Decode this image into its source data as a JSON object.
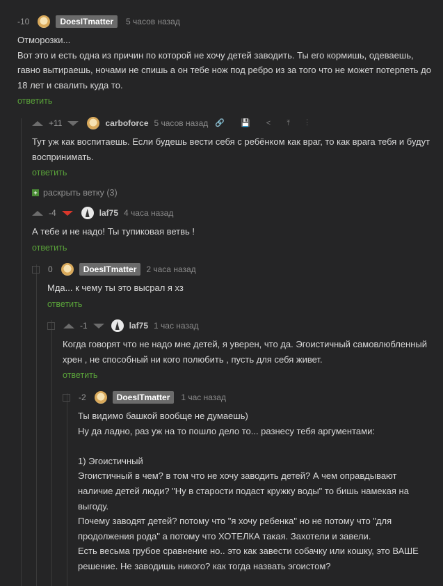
{
  "c1": {
    "rating": "-10",
    "author": "DoesITmatter",
    "time": "5 часов назад",
    "lines": [
      "Отморозки...",
      "Вот это и есть одна из причин по которой не хочу детей заводить. Ты его кормишь, одеваешь,",
      "гавно вытираешь, ночами не спишь а он тебе нож под ребро из за того что не может потерпеть до",
      "18 лет и свалить куда то."
    ],
    "reply": "ответить"
  },
  "c2": {
    "rating": "+11",
    "author": "carboforce",
    "time": "5 часов назад",
    "tools": "🔗 💾 < ⤒ ⋮",
    "lines": [
      "Тут уж как воспитаешь. Если будешь вести себя с ребёнком как враг, то как врага тебя и будут",
      "воспринимать."
    ],
    "reply": "ответить"
  },
  "branch": "раскрыть ветку (3)",
  "c3": {
    "rating": "-4",
    "author": "laf75",
    "time": "4 часа назад",
    "lines": [
      "А тебе и не надо! Ты тупиковая ветвь !"
    ],
    "reply": "ответить"
  },
  "c4": {
    "rating": "0",
    "author": "DoesITmatter",
    "time": "2 часа назад",
    "lines": [
      "Мда... к чему ты это высрал я хз"
    ],
    "reply": "ответить"
  },
  "c5": {
    "rating": "-1",
    "author": "laf75",
    "time": "1 час назад",
    "lines": [
      "Когда говорят что не надо мне детей, я уверен, что да. Эгоистичный самовлюбленный",
      "хрен , не способный ни кого полюбить , пусть для себя живет."
    ],
    "reply": "ответить"
  },
  "c6": {
    "rating": "-2",
    "author": "DoesITmatter",
    "time": "1 час назад",
    "lines": [
      "Ты видимо башкой вообще не думаешь)",
      "Ну да ладно, раз уж на то пошло дело то... разнесу тебя аргументами:",
      " ",
      "1) Эгоистичный",
      "Эгоистичный в чем? в том что не хочу заводить детей? А чем оправдывают",
      "наличие детей люди? \"Ну в старости подаст кружку воды\" то бишь намекая на",
      "выгоду.",
      "Почему заводят детей? потому что \"я хочу ребенка\" но не потому что \"для",
      "продолжения рода\" а потому что ХОТЕЛКА такая. Захотели и завели.",
      "Есть весьма грубое сравнение но.. это как завести собачку или кошку, это ВАШЕ",
      "решение. Не заводишь никого? как тогда назвать эгоистом?"
    ]
  }
}
